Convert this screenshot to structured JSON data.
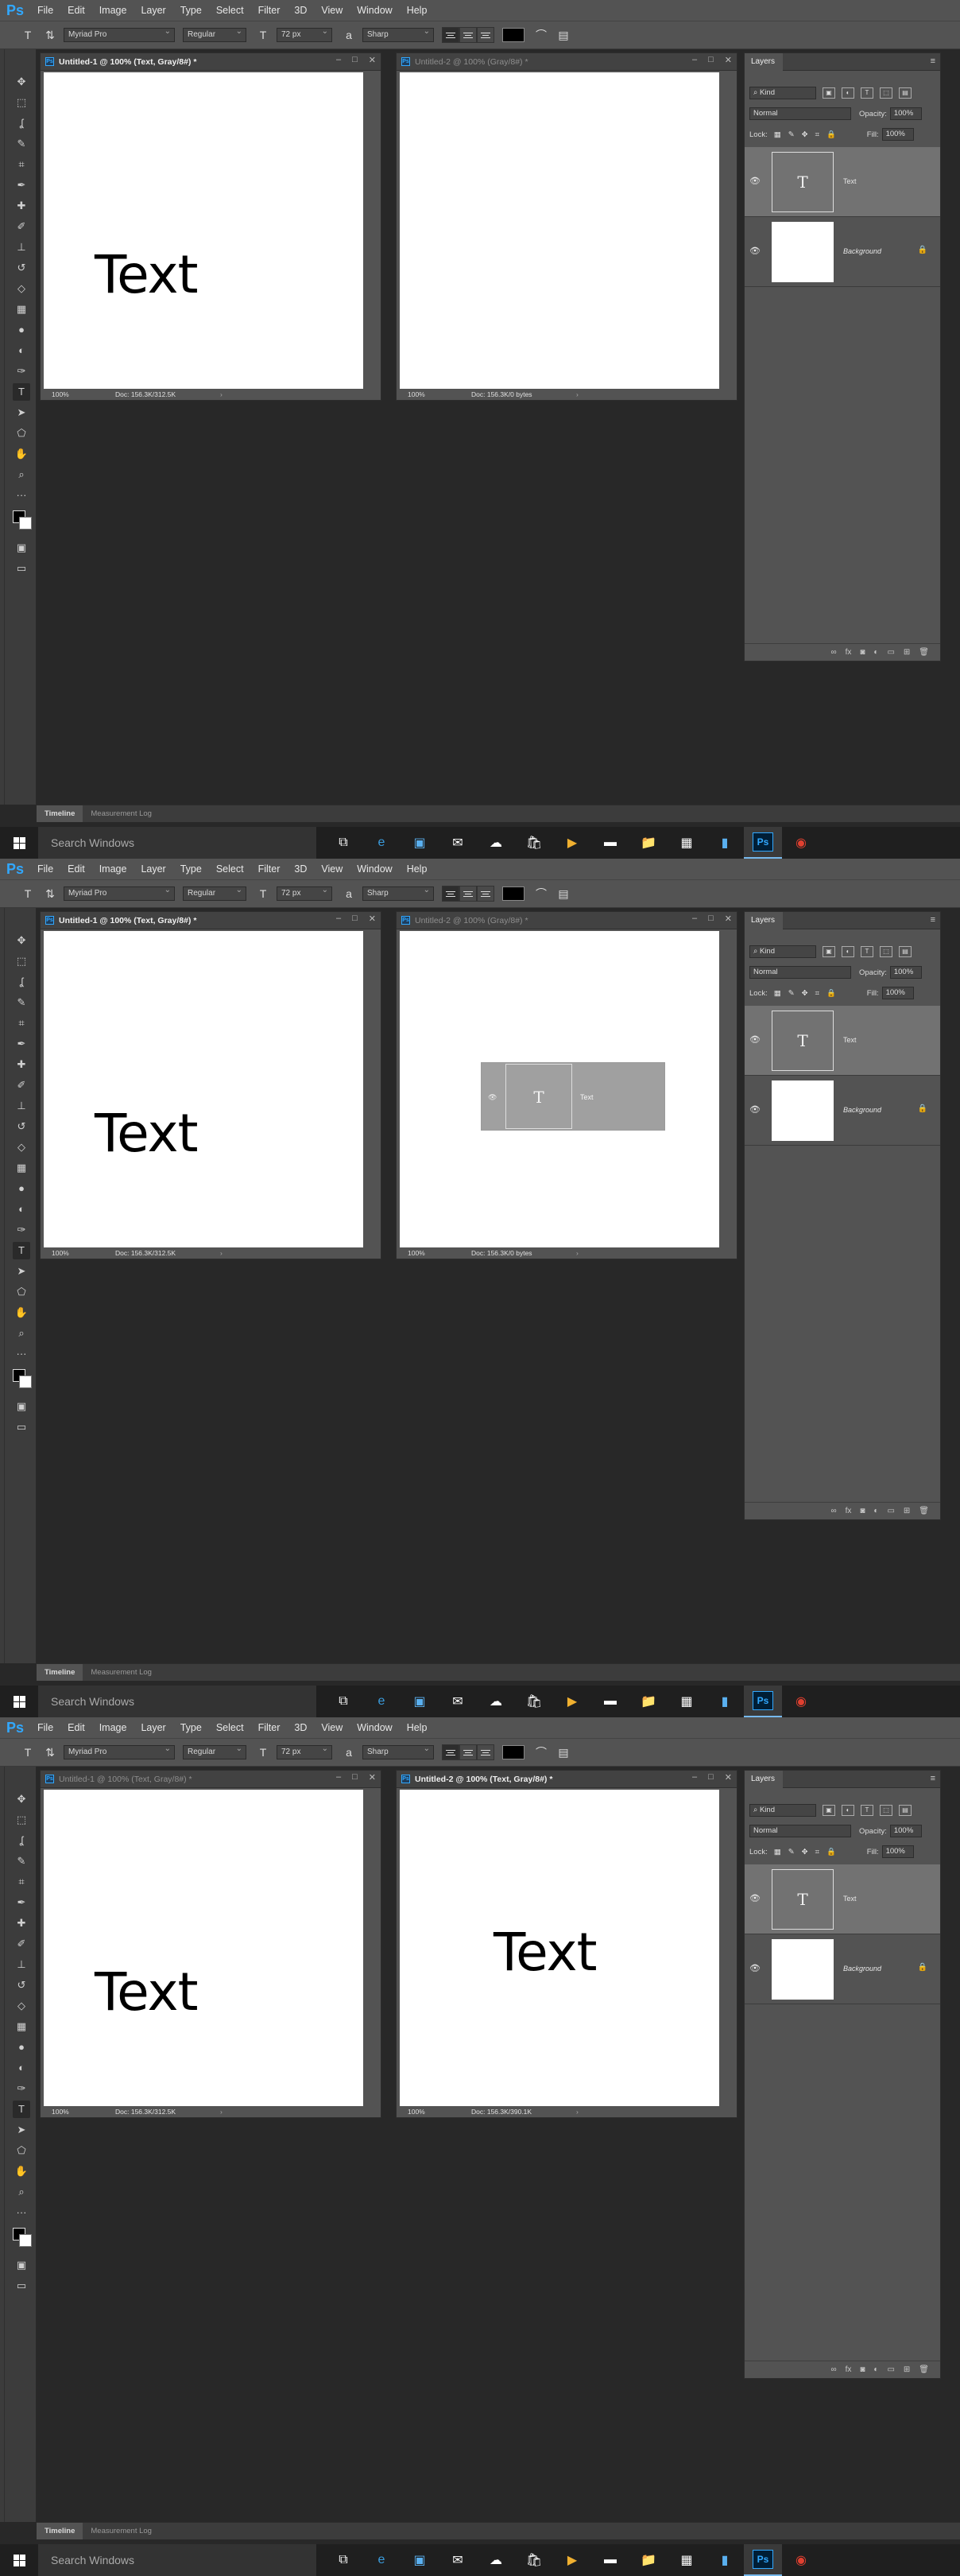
{
  "app": {
    "logo": "Ps"
  },
  "menu": [
    "File",
    "Edit",
    "Image",
    "Layer",
    "Type",
    "Select",
    "Filter",
    "3D",
    "View",
    "Window",
    "Help"
  ],
  "options": {
    "font_family": "Myriad Pro",
    "font_style": "Regular",
    "font_size": "72 px",
    "antialias": "Sharp",
    "text_color": "#000000"
  },
  "layers_panel": {
    "title": "Layers",
    "filter": "Kind",
    "blend_mode": "Normal",
    "opacity_label": "Opacity:",
    "opacity": "100%",
    "lock_label": "Lock:",
    "fill_label": "Fill:",
    "fill": "100%",
    "layer_text": "Text",
    "layer_bg": "Background"
  },
  "bottom_tabs": [
    "Timeline",
    "Measurement Log"
  ],
  "taskbar": {
    "search_placeholder": "Search Windows"
  },
  "states": [
    {
      "doc1_title": "Untitled-1 @ 100% (Text, Gray/8#) *",
      "doc1_status": "Doc: 156.3K/312.5K",
      "doc2_title": "Untitled-2 @ 100% (Gray/8#) *",
      "doc2_status": "Doc: 156.3K/0 bytes",
      "zoom": "100%",
      "canvas1_text": "Text",
      "canvas2_text": "",
      "ghost_label": ""
    },
    {
      "doc1_title": "Untitled-1 @ 100% (Text, Gray/8#) *",
      "doc1_status": "Doc: 156.3K/312.5K",
      "doc2_title": "Untitled-2 @ 100% (Gray/8#) *",
      "doc2_status": "Doc: 156.3K/0 bytes",
      "zoom": "100%",
      "canvas1_text": "Text",
      "canvas2_text": "",
      "ghost_label": "Text"
    },
    {
      "doc1_title": "Untitled-1 @ 100% (Text, Gray/8#) *",
      "doc1_status": "Doc: 156.3K/312.5K",
      "doc2_title": "Untitled-2 @ 100% (Text, Gray/8#) *",
      "doc2_status": "Doc: 156.3K/390.1K",
      "zoom": "100%",
      "canvas1_text": "Text",
      "canvas2_text": "Text",
      "ghost_label": ""
    }
  ]
}
